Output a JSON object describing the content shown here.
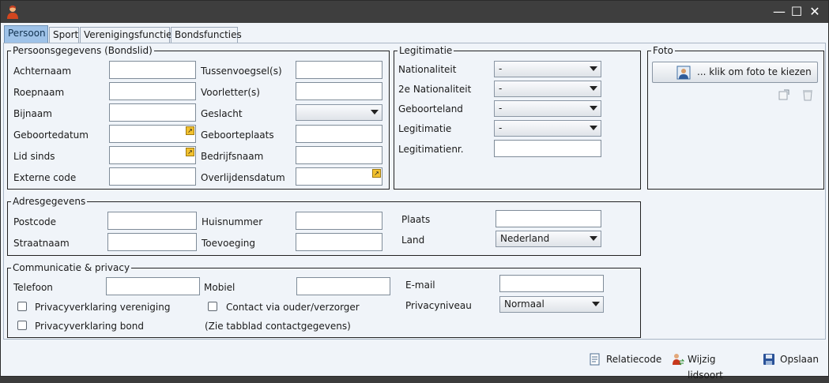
{
  "titlebar": {
    "minimize": "—",
    "maximize": "☐",
    "close": "✕"
  },
  "tabs": [
    "Persoon",
    "Sport",
    "Verenigingsfuncties",
    "Bondsfuncties"
  ],
  "persoonsgegevens": {
    "title": "Persoonsgegevens (Bondslid)",
    "left_labels": [
      "Achternaam",
      "Roepnaam",
      "Bijnaam",
      "Geboortedatum",
      "Lid sinds",
      "Externe code"
    ],
    "right_labels": [
      "Tussenvoegsel(s)",
      "Voorletter(s)",
      "Geslacht",
      "Geboorteplaats",
      "Bedrijfsnaam",
      "Overlijdensdatum"
    ],
    "geslacht_value": ""
  },
  "legitimatie": {
    "title": "Legitimatie",
    "labels": [
      "Nationaliteit",
      "2e Nationaliteit",
      "Geboorteland",
      "Legitimatie",
      "Legitimatienr."
    ],
    "values": [
      "-",
      "-",
      "-",
      "-"
    ]
  },
  "foto": {
    "title": "Foto",
    "button_label": "... klik om foto te kiezen"
  },
  "adres": {
    "title": "Adresgegevens",
    "labels": [
      "Postcode",
      "Straatnaam",
      "Huisnummer",
      "Toevoeging",
      "Plaats",
      "Land"
    ],
    "land_value": "Nederland"
  },
  "communicatie": {
    "title": "Communicatie & privacy",
    "labels": [
      "Telefoon",
      "Mobiel",
      "E-mail",
      "Privacyniveau"
    ],
    "checkboxes": [
      "Privacyverklaring vereniging",
      "Privacyverklaring bond",
      "Contact via ouder/verzorger"
    ],
    "note": "(Zie tabblad contactgegevens)",
    "privacy_value": "Normaal"
  },
  "footer": {
    "relatiecode": "Relatiecode",
    "wijzig": "Wijzig lidsoort",
    "opslaan": "Opslaan"
  }
}
